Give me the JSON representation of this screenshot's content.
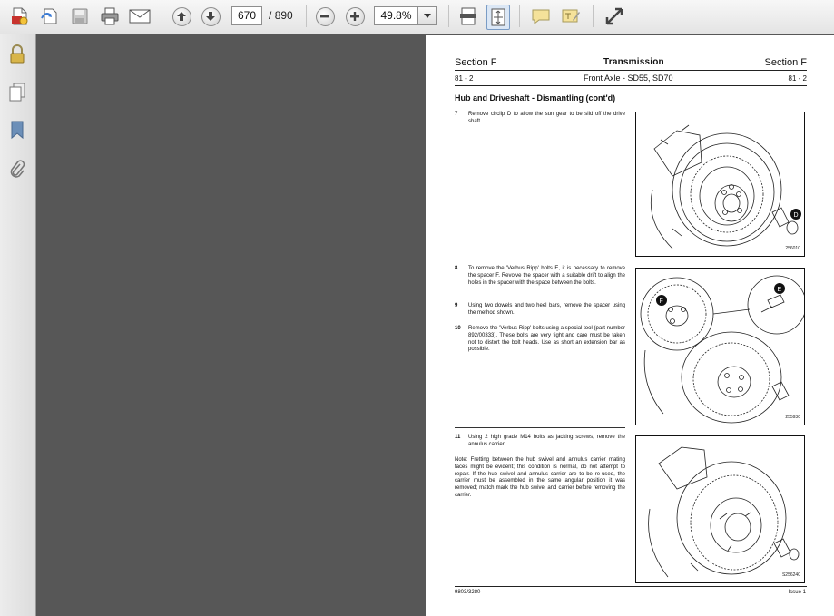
{
  "toolbar": {
    "current_page": "670",
    "page_separator": "/",
    "total_pages": "890",
    "zoom": "49.8%",
    "icons": [
      "create-pdf-icon",
      "edit-icon",
      "save-icon",
      "print-icon",
      "email-icon",
      "prev-page-icon",
      "next-page-icon",
      "zoom-out-icon",
      "zoom-in-icon",
      "fit-width-icon",
      "fit-page-icon",
      "comment-icon",
      "highlight-icon",
      "expand-icon"
    ]
  },
  "sidebar": {
    "icons": [
      "lock-icon",
      "pages-icon",
      "bookmark-icon",
      "attachment-icon"
    ]
  },
  "document": {
    "header_left": "Section F",
    "header_center": "Transmission",
    "header_right": "Section F",
    "sub_left": "81 - 2",
    "sub_center": "Front Axle - SD55, SD70",
    "sub_right": "81 - 2",
    "title": "Hub and Driveshaft - Dismantling (cont'd)",
    "steps": [
      {
        "num": "7",
        "text": "Remove circlip D to allow the sun gear to be slid off the drive shaft."
      },
      {
        "num": "8",
        "text": "To remove the 'Verbus Ripp' bolts E, it is necessary to remove the spacer F. Revolve the spacer with a suitable drift to align the holes in the spacer with the space between the bolts."
      },
      {
        "num": "9",
        "text": "Using two dowels and two heel bars, remove the spacer using the method shown."
      },
      {
        "num": "10",
        "text": "Remove the 'Verbus Ripp' bolts using a special tool (part number 892/00333). These bolts are very tight and care must be taken not to distort the bolt heads. Use as short an extension bar as possible."
      },
      {
        "num": "11",
        "text": "Using 2 high grade M14 bolts as jacking screws, remove the annulus carrier."
      }
    ],
    "note": "Note: Fretting between the hub swivel and annulus carrier mating faces might be evident; this condition is normal, do not attempt to repair. If the hub swivel and annulus carrier are to be re-used, the carrier must be assembled in the same angular position it was removed; match mark the hub swivel and carrier before removing the carrier.",
    "figures": [
      {
        "code": "256010",
        "label": "D"
      },
      {
        "code": "255930",
        "label_f": "F",
        "label_e": "E"
      },
      {
        "code": "S256240"
      }
    ],
    "footer_left": "9803/3280",
    "footer_right": "Issue 1"
  }
}
